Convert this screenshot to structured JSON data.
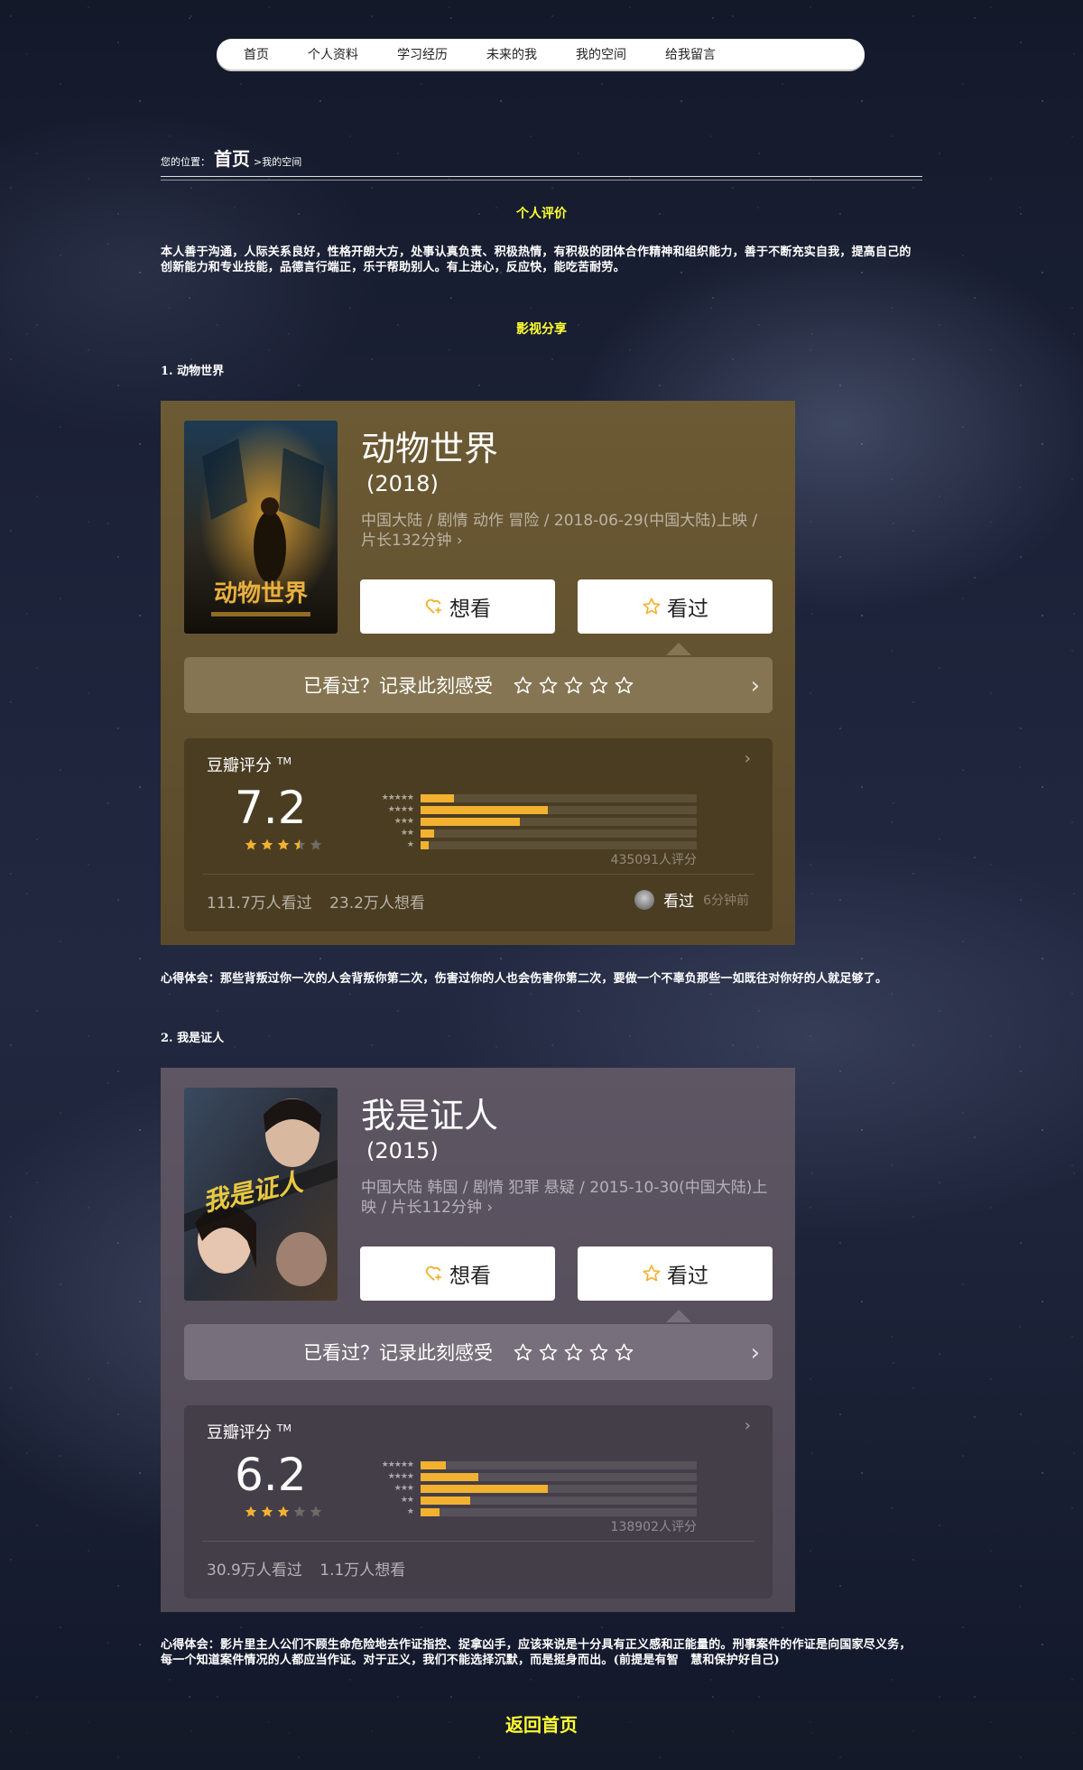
{
  "nav": [
    "首页",
    "个人资料",
    "学习经历",
    "未来的我",
    "我的空间",
    "给我留言"
  ],
  "breadcrumb": {
    "label": "您的位置：",
    "home": "首页",
    "current": ">我的空间"
  },
  "self_eval": {
    "title": "个人评价",
    "text": "本人善于沟通，人际关系良好，性格开朗大方，处事认真负责、积极热情，有积极的团体合作精神和组织能力，善于不断充实自我，提高自己的创新能力和专业技能，品德言行端正，乐于帮助别人。有上进心，反应快，能吃苦耐劳。"
  },
  "share_title": "影视分享",
  "movies": [
    {
      "heading": "1. 动物世界",
      "title": "动物世界",
      "year": "(2018)",
      "meta": "中国大陆 / 剧情 动作 冒险 / 2018-06-29(中国大陆)上映 / 片长132分钟 ›",
      "want_label": "想看",
      "seen_label": "看过",
      "record_label": "已看过？记录此刻感受",
      "rating_label": "豆瓣评分",
      "tm": "TM",
      "score": "7.2",
      "stars": 3.5,
      "hist": [
        0.12,
        0.46,
        0.36,
        0.05,
        0.03
      ],
      "count": "435091人评分",
      "seen_count": "111.7万人看过",
      "want_count": "23.2万人想看",
      "activity_label": "看过",
      "activity_time": "6分钟前",
      "review": "心得体会：那些背叛过你一次的人会背叛你第二次，伤害过你的人也会伤害你第二次，要做一个不辜负那些一如既往对你好的人就足够了。"
    },
    {
      "heading": "2. 我是证人",
      "title": "我是证人",
      "year": "(2015)",
      "meta": "中国大陆 韩国 / 剧情 犯罪 悬疑 / 2015-10-30(中国大陆)上映 / 片长112分钟 ›",
      "want_label": "想看",
      "seen_label": "看过",
      "record_label": "已看过？记录此刻感受",
      "rating_label": "豆瓣评分",
      "tm": "TM",
      "score": "6.2",
      "stars": 3,
      "hist": [
        0.09,
        0.21,
        0.46,
        0.18,
        0.07
      ],
      "count": "138902人评分",
      "seen_count": "30.9万人看过",
      "want_count": "1.1万人想看",
      "review": "心得体会：影片里主人公们不顾生命危险地去作证指控、捉拿凶手，应该来说是十分具有正义感和正能量的。刑事案件的作证是向国家尽义务，每一个知道案件情况的人都应当作证。对于正义，我们不能选择沉默，而是挺身而出。(前提是有智　慧和保护好自己)"
    }
  ],
  "poster_texts": [
    "动物世界",
    "我是证人"
  ],
  "back_label": "返回首页",
  "colors": {
    "accent": "#ffff33",
    "gold_card": "#6c5a34",
    "gray_card": "#5e5663",
    "bar": "#f2b230"
  }
}
